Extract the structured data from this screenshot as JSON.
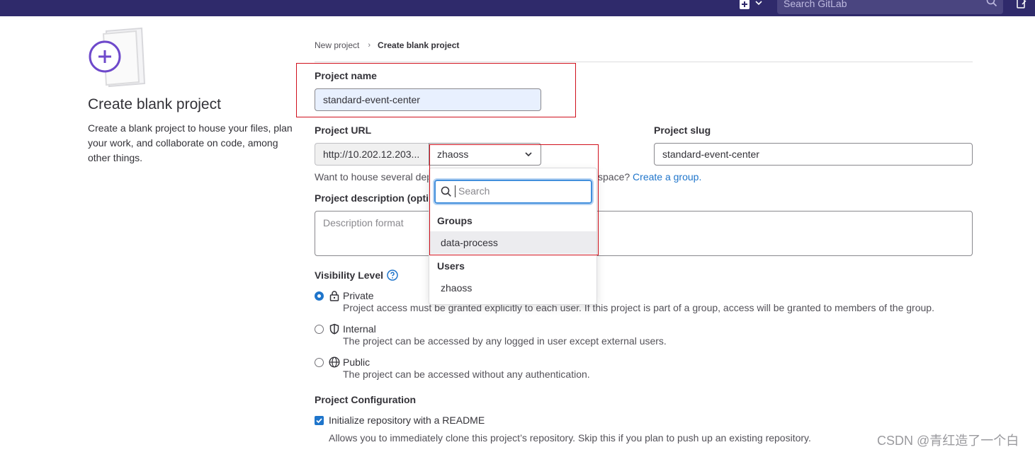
{
  "topbar": {
    "search_placeholder": "Search GitLab",
    "icons": [
      "plus-square-icon",
      "chevron-down-icon",
      "search-icon",
      "todo-icon"
    ]
  },
  "left": {
    "title": "Create blank project",
    "description": "Create a blank project to house your files, plan your work, and collaborate on code, among other things."
  },
  "breadcrumb": {
    "parent": "New project",
    "separator": "›",
    "current": "Create blank project"
  },
  "form": {
    "project_name_label": "Project name",
    "project_name_value": "standard-event-center",
    "project_url_label": "Project URL",
    "url_prefix": "http://10.202.12.203...",
    "namespace_value": "zhaoss",
    "project_slug_label": "Project slug",
    "project_slug_value": "standard-event-center",
    "namespace_help_start": "Want to house several dep",
    "namespace_help_end": "space?",
    "create_group_link": "Create a group.",
    "description_label": "Project description (optio",
    "description_placeholder": "Description format"
  },
  "namespace_dropdown": {
    "search_placeholder": "Search",
    "groups_header": "Groups",
    "groups": [
      "data-process"
    ],
    "users_header": "Users",
    "users": [
      "zhaoss"
    ]
  },
  "visibility": {
    "label": "Visibility Level",
    "options": [
      {
        "title": "Private",
        "description": "Project access must be granted explicitly to each user. If this project is part of a group, access will be granted to members of the group.",
        "checked": true,
        "icon": "lock-icon"
      },
      {
        "title": "Internal",
        "description": "The project can be accessed by any logged in user except external users.",
        "checked": false,
        "icon": "shield-icon"
      },
      {
        "title": "Public",
        "description": "The project can be accessed without any authentication.",
        "checked": false,
        "icon": "globe-icon"
      }
    ]
  },
  "config": {
    "label": "Project Configuration",
    "readme_label": "Initialize repository with a README",
    "readme_checked": true,
    "readme_help": "Allows you to immediately clone this project’s repository. Skip this if you plan to push up an existing repository."
  },
  "watermark": "CSDN @青红造了一个白",
  "colors": {
    "topbar": "#2f2a6b",
    "link": "#1f75cb",
    "highlight_box": "#d0101c",
    "autofill": "#e8f0fe"
  }
}
